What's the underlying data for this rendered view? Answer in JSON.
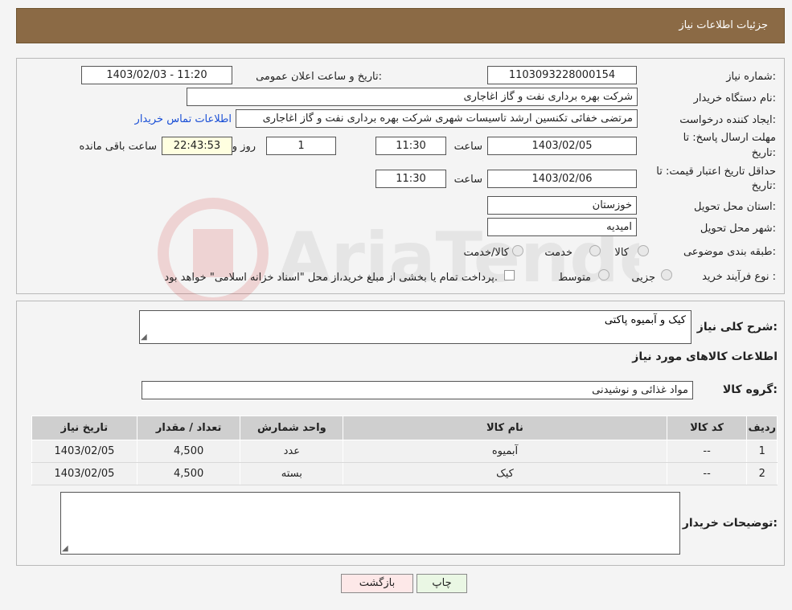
{
  "header": {
    "title": "جزئیات اطلاعات نیاز"
  },
  "info": {
    "need_number_label": "شماره نیاز:",
    "need_number": "1103093228000154",
    "announce_label": "تاریخ و ساعت اعلان عمومی:",
    "announce_value": "1403/02/03 - 11:20",
    "buyer_org_label": "نام دستگاه خریدار:",
    "buyer_org": "شرکت بهره برداری نفت و گاز اغاجاری",
    "requester_label": "ایجاد کننده درخواست:",
    "requester": "مرتضی خفائی تکنسین ارشد تاسیسات شهری شرکت بهره برداری نفت و گاز اغاجاری",
    "contact_link": "اطلاعات تماس خریدار",
    "deadline_label_1": "مهلت ارسال پاسخ: تا",
    "deadline_label_2": "تاریخ:",
    "deadline_date": "1403/02/05",
    "time_label": "ساعت",
    "deadline_time": "11:30",
    "days_value": "1",
    "days_label": "روز و",
    "remaining_time": "22:43:53",
    "remaining_label": "ساعت باقی مانده",
    "validity_label_1": "حداقل تاریخ اعتبار قیمت: تا",
    "validity_label_2": "تاریخ:",
    "validity_date": "1403/02/06",
    "validity_time": "11:30",
    "province_label": "استان محل تحویل:",
    "province": "خوزستان",
    "city_label": "شهر محل تحویل:",
    "city": "امیدیه",
    "category_label": "طبقه بندی موضوعی:",
    "category_options": [
      "کالا",
      "خدمت",
      "کالا/خدمت"
    ],
    "purchase_type_label": "نوع فرآیند خرید :",
    "purchase_options": [
      "جزیی",
      "متوسط"
    ],
    "payment_note": "پرداخت تمام یا بخشی از مبلغ خرید،از محل \"اسناد خزانه اسلامی\" خواهد بود."
  },
  "details": {
    "description_label": "شرح کلی نیاز:",
    "description": "کیک و آبمیوه پاکتی",
    "goods_info_title": "اطلاعات کالاهای مورد نیاز",
    "group_label": "گروه کالا:",
    "group_value": "مواد غذائی و نوشیدنی",
    "table": {
      "headers": [
        "ردیف",
        "کد کالا",
        "نام کالا",
        "واحد شمارش",
        "تعداد / مقدار",
        "تاریخ نیاز"
      ],
      "rows": [
        [
          "1",
          "--",
          "آبمیوه",
          "عدد",
          "4,500",
          "1403/02/05"
        ],
        [
          "2",
          "--",
          "کیک",
          "بسته",
          "4,500",
          "1403/02/05"
        ]
      ]
    },
    "buyer_notes_label": "توضیحات خریدار:",
    "buyer_notes": ""
  },
  "buttons": {
    "print": "چاپ",
    "back": "بازگشت"
  },
  "colors": {
    "header_bg": "#8b6a45",
    "link": "#1a4fd6",
    "print_bg": "#eaf7e4",
    "back_bg": "#fde8e8"
  }
}
